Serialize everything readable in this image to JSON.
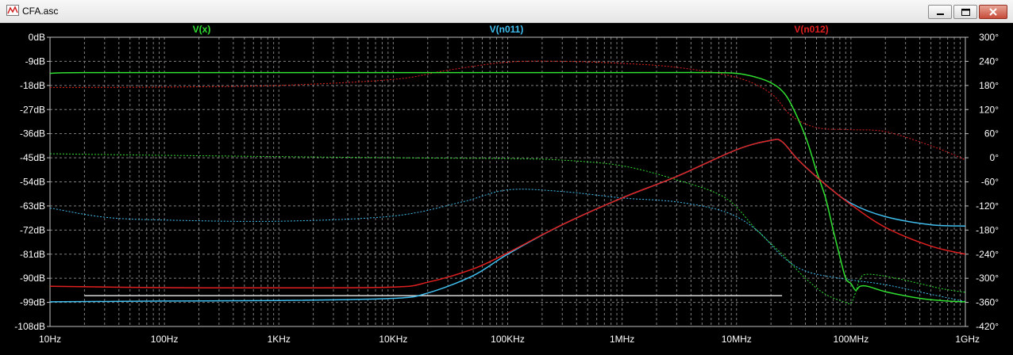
{
  "window": {
    "title": "CFA.asc"
  },
  "icons": {
    "app": "waveform-icon",
    "minimize": "minimize-icon",
    "maximize": "maximize-icon",
    "close": "close-icon"
  },
  "colors": {
    "background": "#000000",
    "grid": "#808080",
    "text": "#ffffff",
    "vx": "#30e030",
    "vn011": "#40bff0",
    "vn012": "#e02020",
    "marker": "#d8d8d8"
  },
  "chart_data": {
    "type": "line",
    "xscale": "log",
    "xlim": [
      10,
      1000000000
    ],
    "ylim_left": [
      -108,
      0
    ],
    "ylim_right": [
      -420,
      300
    ],
    "grid": true,
    "legend": [
      "V(x)",
      "V(n011)",
      "V(n012)"
    ],
    "xticks": [
      "10Hz",
      "100Hz",
      "1KHz",
      "10KHz",
      "100KHz",
      "1MHz",
      "10MHz",
      "100MHz",
      "1GHz"
    ],
    "yticks_left": [
      "0dB",
      "-9dB",
      "-18dB",
      "-27dB",
      "-36dB",
      "-45dB",
      "-54dB",
      "-63dB",
      "-72dB",
      "-81dB",
      "-90dB",
      "-99dB",
      "-108dB"
    ],
    "yticks_right": [
      "300°",
      "240°",
      "180°",
      "120°",
      "60°",
      "0°",
      "-60°",
      "-120°",
      "-180°",
      "-240°",
      "-300°",
      "-360°",
      "-420°"
    ],
    "series": [
      {
        "name": "V(x)",
        "color": "#30e030",
        "magnitude_db": [
          [
            10,
            -13.5
          ],
          [
            20,
            -13.2
          ],
          [
            1000,
            -13.2
          ],
          [
            1000000,
            -13.2
          ],
          [
            5000000,
            -13.2
          ],
          [
            10000000,
            -13.5
          ],
          [
            15000000,
            -15
          ],
          [
            20000000,
            -17
          ],
          [
            25000000,
            -20
          ],
          [
            30000000,
            -25
          ],
          [
            40000000,
            -37
          ],
          [
            50000000,
            -50
          ],
          [
            60000000,
            -60
          ],
          [
            70000000,
            -72
          ],
          [
            80000000,
            -82
          ],
          [
            90000000,
            -90
          ],
          [
            100000000,
            -92
          ],
          [
            110000000,
            -94.5
          ],
          [
            120000000,
            -93
          ],
          [
            140000000,
            -93
          ],
          [
            200000000,
            -95
          ],
          [
            400000000,
            -97.5
          ],
          [
            700000000,
            -98.5
          ],
          [
            1000000000,
            -98.8
          ]
        ],
        "phase_deg": [
          [
            10,
            10
          ],
          [
            100,
            6
          ],
          [
            10000,
            0
          ],
          [
            100000,
            -2
          ],
          [
            300000,
            -6
          ],
          [
            1000000,
            -20
          ],
          [
            3000000,
            -55
          ],
          [
            8000000,
            -100
          ],
          [
            15000000,
            -180
          ],
          [
            25000000,
            -240
          ],
          [
            40000000,
            -300
          ],
          [
            60000000,
            -340
          ],
          [
            90000000,
            -360
          ],
          [
            100000000,
            -362
          ],
          [
            110000000,
            -335
          ],
          [
            120000000,
            -302
          ],
          [
            140000000,
            -290
          ],
          [
            250000000,
            -300
          ],
          [
            600000000,
            -325
          ],
          [
            1000000000,
            -335
          ]
        ]
      },
      {
        "name": "V(n011)",
        "color": "#40bff0",
        "magnitude_db": [
          [
            10,
            -98.8
          ],
          [
            100,
            -98.5
          ],
          [
            1000,
            -98.3
          ],
          [
            10000,
            -97.5
          ],
          [
            20000,
            -95.5
          ],
          [
            50000,
            -89
          ],
          [
            100000,
            -81
          ],
          [
            300000,
            -70
          ],
          [
            1000000,
            -60
          ],
          [
            3000000,
            -52
          ],
          [
            10000000,
            -42
          ],
          [
            20000000,
            -38.5
          ],
          [
            25000000,
            -39
          ],
          [
            35000000,
            -46
          ],
          [
            60000000,
            -55
          ],
          [
            100000000,
            -62
          ],
          [
            200000000,
            -67
          ],
          [
            500000000,
            -70
          ],
          [
            1000000000,
            -70.5
          ]
        ],
        "phase_deg": [
          [
            10,
            -125
          ],
          [
            30,
            -148
          ],
          [
            100,
            -155
          ],
          [
            1000,
            -158
          ],
          [
            10000,
            -145
          ],
          [
            40000,
            -110
          ],
          [
            100000,
            -80
          ],
          [
            300000,
            -84
          ],
          [
            1000000,
            -100
          ],
          [
            3000000,
            -110
          ],
          [
            8000000,
            -135
          ],
          [
            15000000,
            -180
          ],
          [
            25000000,
            -245
          ],
          [
            40000000,
            -282
          ],
          [
            80000000,
            -300
          ],
          [
            200000000,
            -316
          ],
          [
            500000000,
            -340
          ],
          [
            1000000000,
            -358
          ]
        ]
      },
      {
        "name": "V(n012)",
        "color": "#e02020",
        "magnitude_db": [
          [
            10,
            -93
          ],
          [
            100,
            -93.5
          ],
          [
            1000,
            -93.6
          ],
          [
            10000,
            -93.3
          ],
          [
            20000,
            -91.5
          ],
          [
            50000,
            -86.5
          ],
          [
            100000,
            -80.5
          ],
          [
            300000,
            -70
          ],
          [
            1000000,
            -60
          ],
          [
            3000000,
            -52
          ],
          [
            10000000,
            -42
          ],
          [
            20000000,
            -38.5
          ],
          [
            25000000,
            -39
          ],
          [
            35000000,
            -46
          ],
          [
            60000000,
            -55
          ],
          [
            100000000,
            -62.5
          ],
          [
            200000000,
            -71
          ],
          [
            500000000,
            -78
          ],
          [
            1000000000,
            -81
          ]
        ],
        "phase_deg": [
          [
            10,
            175
          ],
          [
            100,
            176
          ],
          [
            1000,
            180
          ],
          [
            10000,
            195
          ],
          [
            30000,
            218
          ],
          [
            100000,
            238
          ],
          [
            300000,
            240
          ],
          [
            1000000,
            235
          ],
          [
            3000000,
            225
          ],
          [
            10000000,
            200
          ],
          [
            20000000,
            160
          ],
          [
            30000000,
            105
          ],
          [
            50000000,
            75
          ],
          [
            100000000,
            70
          ],
          [
            200000000,
            65
          ],
          [
            500000000,
            30
          ],
          [
            1000000000,
            -5
          ]
        ]
      }
    ],
    "annotation_line": {
      "x": [
        20,
        25000000
      ],
      "y_db": -96.5
    }
  }
}
